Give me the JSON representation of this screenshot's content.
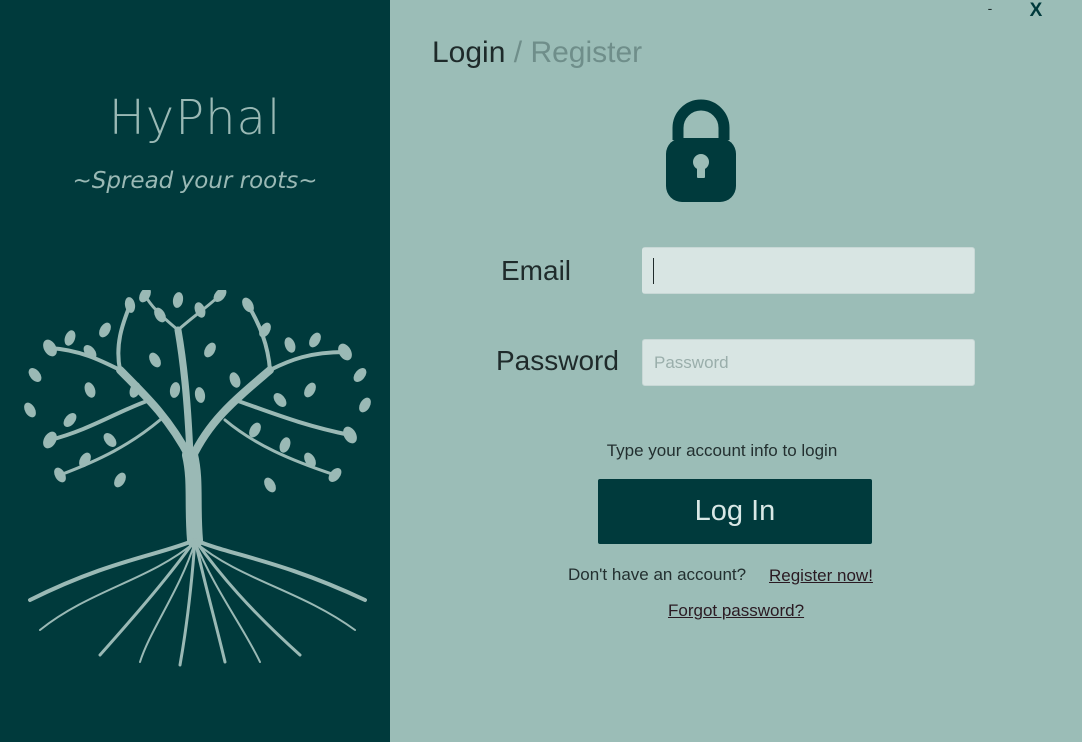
{
  "brand": {
    "title": "HyPhal",
    "tagline": "~Spread your roots~"
  },
  "window": {
    "minimize": "-",
    "close": "X"
  },
  "tabs": {
    "login": "Login",
    "separator": "/",
    "register": "Register"
  },
  "form": {
    "email_label": "Email",
    "email_value": "",
    "password_label": "Password",
    "password_placeholder": "Password",
    "hint": "Type your account info to login",
    "login_button": "Log In"
  },
  "links": {
    "no_account": "Don't have an account?",
    "register_now": "Register now!",
    "forgot_password": "Forgot password?"
  },
  "colors": {
    "left_panel": "#003a3c",
    "right_panel": "#9bbdb7",
    "accent": "#003a3c",
    "tree": "#9ab9b5",
    "input_bg": "#d8e5e3"
  },
  "icons": {
    "lock": "lock-icon",
    "tree": "tree-illustration"
  }
}
